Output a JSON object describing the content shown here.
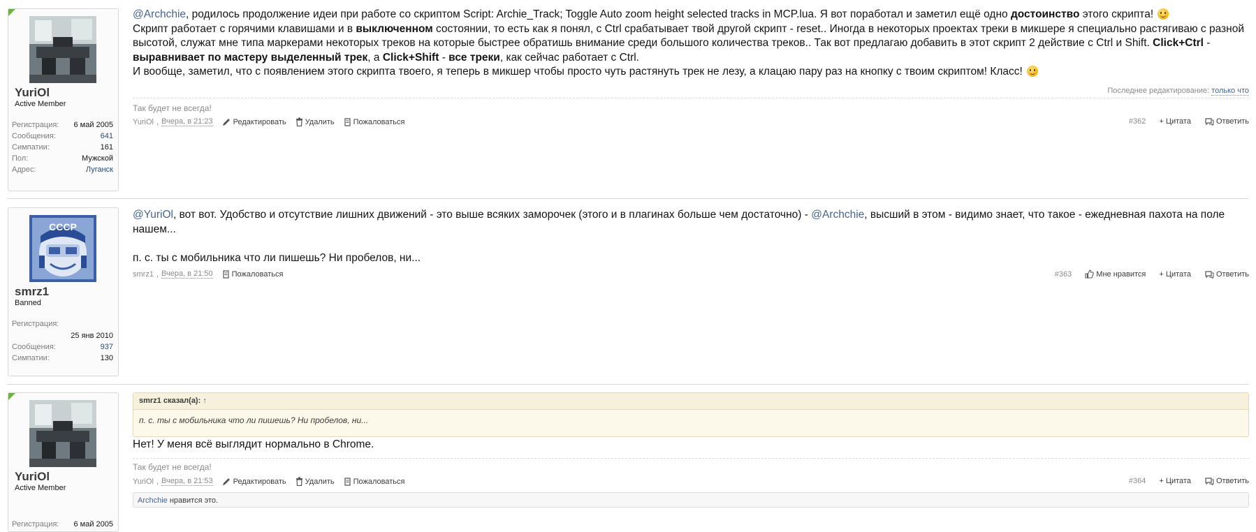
{
  "posts": [
    {
      "author": {
        "name": "YuriOl",
        "title": "Active Member",
        "stats": [
          {
            "label": "Регистрация:",
            "value": "6 май 2005"
          },
          {
            "label": "Сообщения:",
            "value": "641"
          },
          {
            "label": "Симпатии:",
            "value": "161"
          },
          {
            "label": "Пол:",
            "value": "Мужской"
          },
          {
            "label": "Адрес:",
            "value": "Луганск"
          }
        ]
      },
      "message": {
        "m1": "@Archchie",
        "t1": ", родилось продолжение идеи при работе со скриптом Script: Archie_Track; Toggle Auto zoom height selected tracks in MCP.lua. Я вот поработал и заметил ещё одно ",
        "b1": "достоинство",
        "t2": " этого скрипта! ",
        "t3": "Скрипт работает с горячими клавишами и в ",
        "b2": "выключенном",
        "t4": " состоянии, то есть как я понял, с Ctrl срабатывает твой другой скрипт - reset.. Иногда в некоторых проектах треки в микшере я специально растягиваю с разной высотой, служат мне типа маркерами некоторых треков на которые быстрее обратишь внимание среди большого количества треков.. Так вот предлагаю добавить в этот скрипт 2 действие с Ctrl и Shift. ",
        "b3": "Click+Ctrl",
        "t5": " - ",
        "b4": "выравнивает по мастеру выделенный трек",
        "t6": ", а ",
        "b5": "Click+Shift",
        "t7": " - ",
        "b6": "все треки",
        "t8": ", как сейчас работает с Ctrl.",
        "t9": "И вообще, заметил, что с появлением этого скрипта твоего, я теперь в микшер чтобы просто чуть растянуть трек не лезу, а клацаю пару раз на кнопку с твоим скриптом! Класс! "
      },
      "last_edit_label": "Последнее редактирование:",
      "last_edit_value": "только что",
      "signature": "Так будет не всегда!",
      "footer": {
        "author": "YuriOl",
        "sep": ",",
        "date": "Вчера, в 21:23",
        "edit": "Редактировать",
        "delete": "Удалить",
        "report": "Пожаловаться",
        "number": "#362",
        "quote": "+ Цитата",
        "reply": "Ответить"
      }
    },
    {
      "author": {
        "name": "smrz1",
        "title": "Banned",
        "stats": [
          {
            "label": "Регистрация:",
            "value": "25 янв 2010"
          },
          {
            "label": "Сообщения:",
            "value": "937"
          },
          {
            "label": "Симпатии:",
            "value": "130"
          }
        ]
      },
      "message": {
        "m1": "@YuriOl",
        "t1": ", вот вот. Удобство и отсутствие лишних движений - это выше всяких заморочек (этого и в плагинах больше чем достаточно) - ",
        "m2": "@Archchie",
        "t2": ", высший в этом - видимо знает, что такое - ежедневная пахота на поле нашем...",
        "t3": "п. с. ты с мобильника что ли пишешь? Ни пробелов, ни..."
      },
      "footer": {
        "author": "smrz1",
        "sep": ",",
        "date": "Вчера, в 21:50",
        "report": "Пожаловаться",
        "number": "#363",
        "like": "Мне нравится",
        "quote": "+ Цитата",
        "reply": "Ответить"
      }
    },
    {
      "author": {
        "name": "YuriOl",
        "title": "Active Member",
        "stats": [
          {
            "label": "Регистрация:",
            "value": "6 май 2005"
          }
        ]
      },
      "quote": {
        "head": "smrz1 сказал(а):",
        "arrow": "↑",
        "body": "п. с. ты с мобильника что ли пишешь? Ни пробелов, ни..."
      },
      "message": {
        "t1": "Нет! У меня всё выглядит нормально в Chrome."
      },
      "signature": "Так будет не всегда!",
      "footer": {
        "author": "YuriOl",
        "sep": ",",
        "date": "Вчера, в 21:53",
        "edit": "Редактировать",
        "delete": "Удалить",
        "report": "Пожаловаться",
        "number": "#364",
        "quote": "+ Цитата",
        "reply": "Ответить"
      },
      "likes": {
        "user": "Archchie",
        "text": " нравится это."
      }
    }
  ],
  "colors": {
    "mention": "#47658e",
    "corner": "#6cb33f",
    "quote_bg": "#fdf9ea"
  },
  "icons": [
    "pencil-icon",
    "trash-icon",
    "report-icon",
    "thumbs-up-icon",
    "speech-bubble-icon",
    "avatar-studio",
    "avatar-cccp"
  ]
}
